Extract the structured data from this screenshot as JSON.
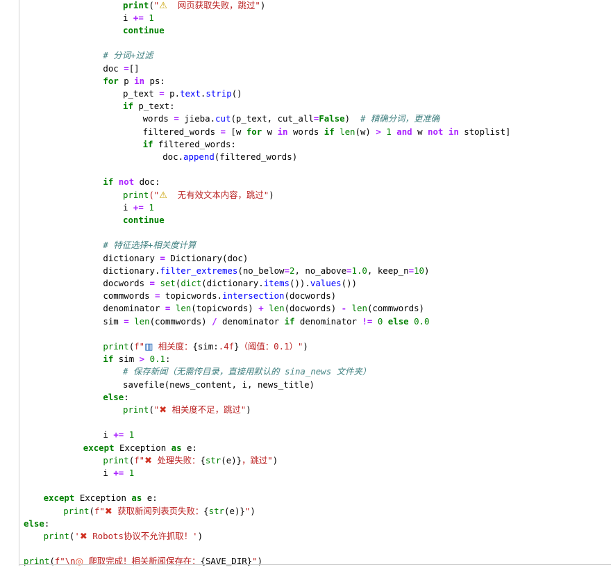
{
  "icons": {
    "warning": "⚠",
    "cross": "✖",
    "chart": "▥",
    "target": "◎"
  },
  "lines": [
    {
      "indent": 5,
      "parts": [
        [
          "kw",
          "print"
        ],
        [
          "",
          "("
        ],
        [
          "st",
          "\""
        ],
        [
          "ic",
          "⚠"
        ],
        [
          "st",
          "  网页获取失败，跳过\""
        ],
        [
          "",
          ")"
        ]
      ]
    },
    {
      "indent": 5,
      "parts": [
        [
          "",
          "i "
        ],
        [
          "op",
          "+="
        ],
        [
          "",
          ""
        ],
        [
          "nu",
          " 1"
        ]
      ]
    },
    {
      "indent": 5,
      "parts": [
        [
          "kw",
          "continue"
        ]
      ]
    },
    {
      "indent": 0,
      "parts": []
    },
    {
      "indent": 4,
      "parts": [
        [
          "cm",
          "# 分词+过滤"
        ]
      ]
    },
    {
      "indent": 4,
      "parts": [
        [
          "",
          "doc "
        ],
        [
          "op",
          "="
        ],
        [
          "",
          ""
        ],
        [
          "",
          "[]"
        ]
      ]
    },
    {
      "indent": 4,
      "parts": [
        [
          "kw",
          "for"
        ],
        [
          "",
          " p "
        ],
        [
          "op",
          "in"
        ],
        [
          "",
          " ps:"
        ]
      ]
    },
    {
      "indent": 5,
      "parts": [
        [
          "",
          "p_text "
        ],
        [
          "op",
          "="
        ],
        [
          "",
          ""
        ],
        [
          "",
          " p."
        ],
        [
          "at",
          "text"
        ],
        [
          "",
          "."
        ],
        [
          "at",
          "strip"
        ],
        [
          "",
          "()"
        ]
      ]
    },
    {
      "indent": 5,
      "parts": [
        [
          "kw",
          "if"
        ],
        [
          "",
          " p_text:"
        ]
      ]
    },
    {
      "indent": 6,
      "parts": [
        [
          "",
          "words "
        ],
        [
          "op",
          "="
        ],
        [
          "",
          " jieba."
        ],
        [
          "at",
          "cut"
        ],
        [
          "",
          "(p_text, cut_all"
        ],
        [
          "op",
          "="
        ],
        [
          "kw",
          "False"
        ],
        [
          "",
          ")  "
        ],
        [
          "cm",
          "# 精确分词，更准确"
        ]
      ]
    },
    {
      "indent": 6,
      "parts": [
        [
          "",
          "filtered_words "
        ],
        [
          "op",
          "="
        ],
        [
          "",
          " [w "
        ],
        [
          "kw",
          "for"
        ],
        [
          "",
          " w "
        ],
        [
          "op",
          "in"
        ],
        [
          "",
          " words "
        ],
        [
          "kw",
          "if"
        ],
        [
          "",
          " "
        ],
        [
          "bi",
          "len"
        ],
        [
          "",
          "(w) "
        ],
        [
          "op",
          ">"
        ],
        [
          "",
          " "
        ],
        [
          "nu",
          "1"
        ],
        [
          "",
          " "
        ],
        [
          "op",
          "and"
        ],
        [
          "",
          " w "
        ],
        [
          "op",
          "not in"
        ],
        [
          "",
          " stoplist]"
        ]
      ]
    },
    {
      "indent": 6,
      "parts": [
        [
          "kw",
          "if"
        ],
        [
          "",
          " filtered_words:"
        ]
      ]
    },
    {
      "indent": 7,
      "parts": [
        [
          "",
          "doc."
        ],
        [
          "at",
          "append"
        ],
        [
          "",
          "(filtered_words)"
        ]
      ]
    },
    {
      "indent": 0,
      "parts": []
    },
    {
      "indent": 4,
      "parts": [
        [
          "kw",
          "if"
        ],
        [
          "",
          " "
        ],
        [
          "op",
          "not"
        ],
        [
          "",
          " doc:"
        ]
      ]
    },
    {
      "indent": 5,
      "parts": [
        [
          "bi",
          "print"
        ],
        [
          "st",
          "(\""
        ],
        [
          "ic",
          "⚠"
        ],
        [
          "st",
          "  无有效文本内容，跳过\""
        ],
        [
          "",
          ")"
        ]
      ]
    },
    {
      "indent": 5,
      "parts": [
        [
          "",
          "i "
        ],
        [
          "op",
          "+="
        ],
        [
          "",
          " "
        ],
        [
          "nu",
          "1"
        ]
      ]
    },
    {
      "indent": 5,
      "parts": [
        [
          "kw",
          "continue"
        ]
      ]
    },
    {
      "indent": 0,
      "parts": []
    },
    {
      "indent": 4,
      "parts": [
        [
          "cm",
          "# 特征选择+相关度计算"
        ]
      ]
    },
    {
      "indent": 4,
      "parts": [
        [
          "",
          "dictionary "
        ],
        [
          "op",
          "="
        ],
        [
          "",
          " Dictionary(doc)"
        ]
      ]
    },
    {
      "indent": 4,
      "parts": [
        [
          "",
          "dictionary."
        ],
        [
          "at",
          "filter_extremes"
        ],
        [
          "",
          "(no_below"
        ],
        [
          "op",
          "="
        ],
        [
          "nu",
          "2"
        ],
        [
          "",
          ", no_above"
        ],
        [
          "op",
          "="
        ],
        [
          "nu",
          "1.0"
        ],
        [
          "",
          ", keep_n"
        ],
        [
          "op",
          "="
        ],
        [
          "nu",
          "10"
        ],
        [
          "",
          ")"
        ]
      ]
    },
    {
      "indent": 4,
      "parts": [
        [
          "",
          "docwords "
        ],
        [
          "op",
          "="
        ],
        [
          "",
          " "
        ],
        [
          "bi",
          "set"
        ],
        [
          "",
          "("
        ],
        [
          "bi",
          "dict"
        ],
        [
          "",
          "(dictionary."
        ],
        [
          "at",
          "items"
        ],
        [
          "",
          "())."
        ],
        [
          "at",
          "values"
        ],
        [
          "",
          "())"
        ]
      ]
    },
    {
      "indent": 4,
      "parts": [
        [
          "",
          "commwords "
        ],
        [
          "op",
          "="
        ],
        [
          "",
          " topicwords."
        ],
        [
          "at",
          "intersection"
        ],
        [
          "",
          "(docwords)"
        ]
      ]
    },
    {
      "indent": 4,
      "parts": [
        [
          "",
          "denominator "
        ],
        [
          "op",
          "="
        ],
        [
          "",
          " "
        ],
        [
          "bi",
          "len"
        ],
        [
          "",
          "(topicwords) "
        ],
        [
          "op",
          "+"
        ],
        [
          "",
          " "
        ],
        [
          "bi",
          "len"
        ],
        [
          "",
          "(docwords) "
        ],
        [
          "op",
          "-"
        ],
        [
          "",
          " "
        ],
        [
          "bi",
          "len"
        ],
        [
          "",
          "(commwords)"
        ]
      ]
    },
    {
      "indent": 4,
      "parts": [
        [
          "",
          "sim "
        ],
        [
          "op",
          "="
        ],
        [
          "",
          " "
        ],
        [
          "bi",
          "len"
        ],
        [
          "",
          "(commwords) "
        ],
        [
          "op",
          "/"
        ],
        [
          "",
          " denominator "
        ],
        [
          "kw",
          "if"
        ],
        [
          "",
          " denominator "
        ],
        [
          "op",
          "!="
        ],
        [
          "",
          " "
        ],
        [
          "nu",
          "0"
        ],
        [
          "",
          " "
        ],
        [
          "kw",
          "else"
        ],
        [
          "",
          " "
        ],
        [
          "nu",
          "0.0"
        ]
      ]
    },
    {
      "indent": 0,
      "parts": []
    },
    {
      "indent": 4,
      "parts": [
        [
          "bi",
          "print"
        ],
        [
          "",
          "("
        ],
        [
          "st",
          "f\""
        ],
        [
          "ic",
          "▥"
        ],
        [
          "st",
          " 相关度："
        ],
        [
          "",
          "{sim:"
        ],
        [
          "st",
          ".4f"
        ],
        [
          "",
          "}"
        ],
        [
          "st",
          "（阈值：0.1）\""
        ],
        [
          "",
          ")"
        ]
      ]
    },
    {
      "indent": 4,
      "parts": [
        [
          "kw",
          "if"
        ],
        [
          "",
          " sim "
        ],
        [
          "op",
          ">"
        ],
        [
          "",
          " "
        ],
        [
          "nu",
          "0.1"
        ],
        [
          "",
          ":"
        ]
      ]
    },
    {
      "indent": 5,
      "parts": [
        [
          "cm",
          "# 保存新闻（无需传目录，直接用默认的 sina_news 文件夹）"
        ]
      ]
    },
    {
      "indent": 5,
      "parts": [
        [
          "",
          "savefile(news_content, i, news_title)"
        ]
      ]
    },
    {
      "indent": 4,
      "parts": [
        [
          "kw",
          "else"
        ],
        [
          "",
          ":"
        ]
      ]
    },
    {
      "indent": 5,
      "parts": [
        [
          "bi",
          "print"
        ],
        [
          "",
          "("
        ],
        [
          "st",
          "\""
        ],
        [
          "ic",
          "✖"
        ],
        [
          "st",
          " 相关度不足，跳过\""
        ],
        [
          "",
          ")"
        ]
      ]
    },
    {
      "indent": 0,
      "parts": []
    },
    {
      "indent": 4,
      "parts": [
        [
          "",
          "i "
        ],
        [
          "op",
          "+="
        ],
        [
          "",
          " "
        ],
        [
          "nu",
          "1"
        ]
      ]
    },
    {
      "indent": 3,
      "parts": [
        [
          "kw",
          "except"
        ],
        [
          "",
          " Exception "
        ],
        [
          "kw",
          "as"
        ],
        [
          "",
          " e:"
        ]
      ]
    },
    {
      "indent": 4,
      "parts": [
        [
          "bi",
          "print"
        ],
        [
          "",
          "("
        ],
        [
          "st",
          "f\""
        ],
        [
          "ic",
          "✖"
        ],
        [
          "st",
          " 处理失败："
        ],
        [
          "",
          "{"
        ],
        [
          "bi",
          "str"
        ],
        [
          "",
          "(e)}"
        ],
        [
          "st",
          "，跳过\""
        ],
        [
          "",
          ")"
        ]
      ]
    },
    {
      "indent": 4,
      "parts": [
        [
          "",
          "i "
        ],
        [
          "op",
          "+="
        ],
        [
          "",
          " "
        ],
        [
          "nu",
          "1"
        ]
      ]
    },
    {
      "indent": 0,
      "parts": []
    },
    {
      "indent": 1,
      "parts": [
        [
          "kw",
          "except"
        ],
        [
          "",
          " Exception "
        ],
        [
          "kw",
          "as"
        ],
        [
          "",
          " e:"
        ]
      ]
    },
    {
      "indent": 2,
      "parts": [
        [
          "bi",
          "print"
        ],
        [
          "",
          "("
        ],
        [
          "st",
          "f\""
        ],
        [
          "ic",
          "✖"
        ],
        [
          "st",
          " 获取新闻列表页失败："
        ],
        [
          "",
          "{"
        ],
        [
          "bi",
          "str"
        ],
        [
          "",
          "(e)}"
        ],
        [
          "st",
          "\""
        ],
        [
          "",
          ")"
        ]
      ]
    },
    {
      "indent": 0,
      "parts": [
        [
          "kw",
          "else"
        ],
        [
          "",
          ":"
        ]
      ]
    },
    {
      "indent": 1,
      "parts": [
        [
          "bi",
          "print"
        ],
        [
          "",
          "("
        ],
        [
          "st",
          "'"
        ],
        [
          "ic",
          "✖"
        ],
        [
          "st",
          " Robots协议不允许抓取！'"
        ],
        [
          "",
          ")"
        ]
      ]
    },
    {
      "indent": 0,
      "parts": []
    },
    {
      "indent": 0,
      "parts": [
        [
          "bi",
          "print"
        ],
        [
          "",
          "("
        ],
        [
          "st",
          "f\"\\n"
        ],
        [
          "ic",
          "◎"
        ],
        [
          "st",
          " 爬取完成！相关新闻保存在："
        ],
        [
          "",
          "{SAVE_DIR}"
        ],
        [
          "st",
          "\""
        ],
        [
          "",
          ")"
        ]
      ]
    }
  ]
}
